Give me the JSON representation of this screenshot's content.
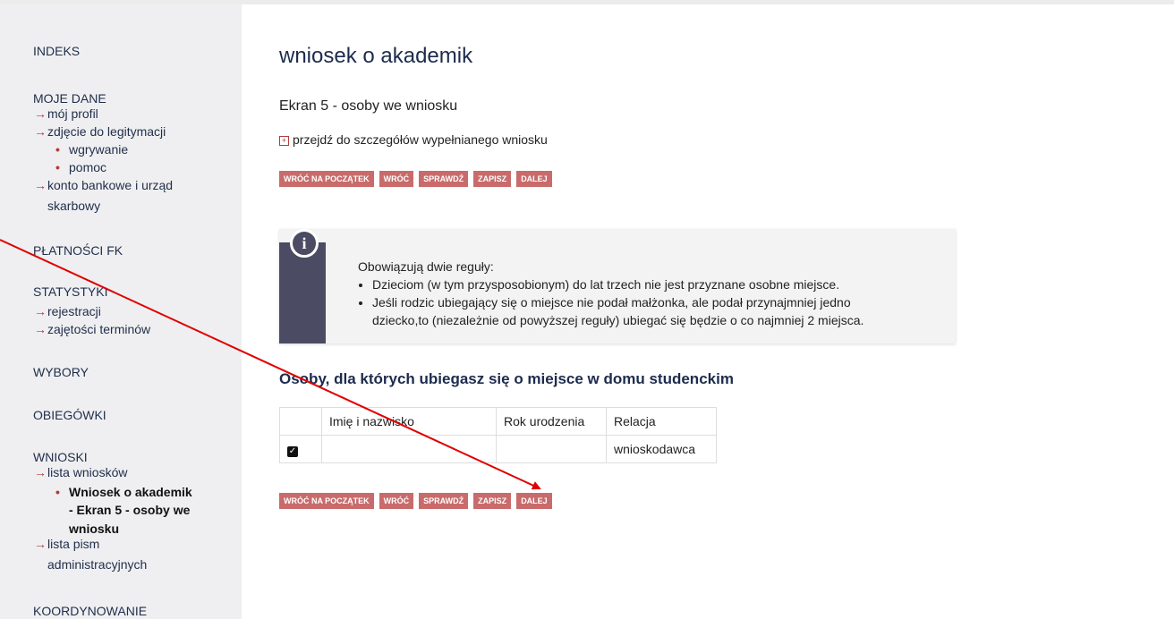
{
  "sidebar": {
    "indeks": "INDEKS",
    "moje_dane": "MOJE DANE",
    "moj_profil": "mój profil",
    "zdjecie": "zdjęcie do legitymacji",
    "wgrywanie": "wgrywanie",
    "pomoc": "pomoc",
    "konto1": "konto bankowe i urząd",
    "konto2": "skarbowy",
    "platnosci": "PŁATNOŚCI FK",
    "statystyki": "STATYSTYKI",
    "rejestracji": "rejestracji",
    "zajetosci": "zajętości terminów",
    "wybory": "WYBORY",
    "obiegowki": "OBIEGÓWKI",
    "wnioski": "WNIOSKI",
    "lista_wnioskow": "lista wniosków",
    "active1": "Wniosek o akademik",
    "active2": "- Ekran 5 - osoby we",
    "active3": "wniosku",
    "lista_pism1": "lista pism",
    "lista_pism2": "administracyjnych",
    "koordynowanie": "KOORDYNOWANIE"
  },
  "main": {
    "title": "wniosek o akademik",
    "subtitle": "Ekran 5 - osoby we wniosku",
    "details_link": "przejdź do szczegółów wypełnianego wniosku",
    "buttons": {
      "start": "WRÓĆ NA POCZĄTEK",
      "back": "WRÓĆ",
      "check": "SPRAWDŹ",
      "save": "ZAPISZ",
      "next": "DALEJ"
    },
    "info": {
      "heading": "Obowiązują dwie reguły:",
      "rule1": "Dzieciom (w tym przysposobionym) do lat trzech nie jest przyznane osobne miejsce.",
      "rule2a": "Jeśli rodzic ubiegający się o miejsce nie podał małżonka, ale podał przynajmniej jedno",
      "rule2b": "dziecko,to (niezależnie od powyższej reguły) ubiegać się będzie o co najmniej 2 miejsca."
    },
    "section_title": "Osoby, dla których ubiegasz się o miejsce w domu studenckim",
    "table": {
      "headers": [
        "",
        "Imię i nazwisko",
        "Rok urodzenia",
        "Relacja"
      ],
      "rows": [
        {
          "checked": true,
          "name": "",
          "year": "",
          "relation": "wnioskodawca"
        }
      ]
    }
  },
  "colors": {
    "accent": "#c96b6b",
    "annotation_arrow": "#e00000",
    "info_bar": "#4b4b64"
  }
}
